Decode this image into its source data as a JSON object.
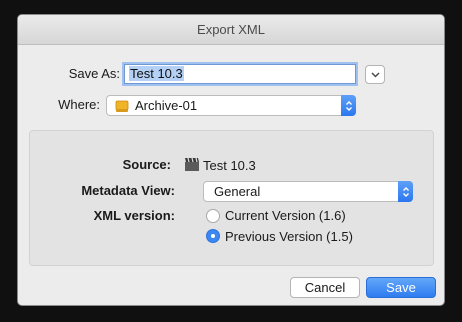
{
  "dialog": {
    "title": "Export XML"
  },
  "save_as": {
    "label": "Save As:",
    "value": "Test 10.3"
  },
  "where": {
    "label": "Where:",
    "value": "Archive-01"
  },
  "details": {
    "source_label": "Source:",
    "source_value": "Test 10.3",
    "metadata_label": "Metadata View:",
    "metadata_value": "General",
    "xml_label": "XML version:",
    "xml_options": [
      "Current Version (1.6)",
      "Previous Version (1.5)"
    ],
    "xml_selected_index": 1
  },
  "buttons": {
    "cancel": "Cancel",
    "save": "Save"
  },
  "colors": {
    "accent": "#3b88f5"
  }
}
